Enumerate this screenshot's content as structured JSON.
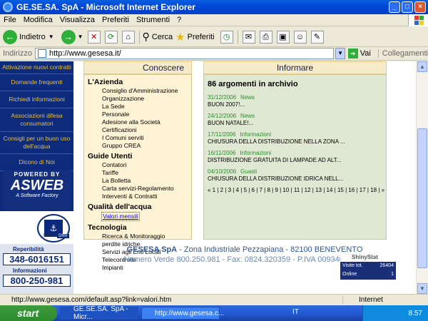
{
  "window": {
    "title": "GE.SE.SA. SpA - Microsoft Internet Explorer"
  },
  "menu": [
    "File",
    "Modifica",
    "Visualizza",
    "Preferiti",
    "Strumenti",
    "?"
  ],
  "toolbar": {
    "back_label": "Indietro",
    "search_label": "Cerca",
    "favorites_label": "Preferiti"
  },
  "address": {
    "label": "Indirizzo",
    "url": "http://www.gesesa.it/",
    "go_label": "Vai",
    "links_label": "Collegamenti"
  },
  "leftnav": {
    "items": [
      "Attivazione nuovi contratti",
      "Domande frequenti",
      "Richiedi informazioni",
      "Associazioni difesa consumatori",
      "Consigli per un buon uso dell'acqua",
      "Dicono di Noi"
    ],
    "powered_by": "POWERED BY",
    "brand": "ASWEB",
    "brand_sub": "A Software Factory",
    "cert_label": "SINCERT",
    "cert_label2": "DNV"
  },
  "phones": {
    "reperibilita_label": "Reperibilità",
    "reperibilita_number": "348-6016151",
    "informazioni_label": "Informazioni",
    "informazioni_number": "800-250-981"
  },
  "conoscere": {
    "header": "Conoscere",
    "sections": [
      {
        "title": "L'Azienda",
        "items": [
          "Consiglio d'Amministrazione",
          "Organizzazione",
          "La Sede",
          "Personale",
          "Adesione alla Società",
          "Certificazioni",
          "I Comuni serviti",
          "Gruppo CREA"
        ]
      },
      {
        "title": "Guide Utenti",
        "items": [
          "Contatori",
          "Tariffe",
          "La Bolletta",
          "Carta servizi-Regolamento",
          "Interventi & Contratti"
        ]
      },
      {
        "title": "Qualità dell'acqua",
        "items": [
          "Valori mensili"
        ]
      },
      {
        "title": "Tecnologia",
        "items": [
          "Ricerca & Monitoraggio",
          "perdite idriche",
          "Servizi agli Enti Locali",
          "Telecontrollo",
          "Impianti"
        ]
      }
    ]
  },
  "informare": {
    "header": "Informare",
    "archive": "86 argomenti in archivio",
    "news": [
      {
        "date": "31/12/2006",
        "category": "News",
        "text": "BUON 2007!..."
      },
      {
        "date": "24/12/2006",
        "category": "News",
        "text": "BUON NATALE!..."
      },
      {
        "date": "17/11/2006",
        "category": "Informazioni",
        "text": "CHIUSURA DELLA DISTRIBUZIONE NELLA ZONA ..."
      },
      {
        "date": "16/11/2006",
        "category": "Informazioni",
        "text": "DISTRIBUZIONE GRATUITA DI LAMPADE AD ALT..."
      },
      {
        "date": "04/10/2006",
        "category": "Guasti",
        "text": "CHIUSURA DELLA DISTRIBUZIONE IDRICA NELL..."
      }
    ],
    "pager": "« 1 | 2 | 3 | 4 | 5 | 6 | 7 | 8 | 9 | 10 | 11 | 12 | 13 | 14 | 15 | 16 | 17 | 18 | »"
  },
  "footer": {
    "company": "GESESA SpA",
    "line1_rest": " - Zona Industriale Pezzapiana - 82100 BENEVENTO",
    "line2": "Numero Verde 800.250.981 - Fax: 0824.320359 - P.IVA 00934000621"
  },
  "counter": {
    "brand": "ShinyStat",
    "visits_label": "Visite tot.",
    "visits_value": "26404",
    "online_label": "Online",
    "online_value": "1"
  },
  "status": {
    "url": "http://www.gesesa.com/default.asp?link=valori.htm",
    "zone": "Internet"
  },
  "taskbar": {
    "start": "start",
    "task1": "GE.SE.SA. SpA - Micr...",
    "task2": "http://www.gesesa.c...",
    "lang": "IT",
    "clock": "8.57"
  }
}
